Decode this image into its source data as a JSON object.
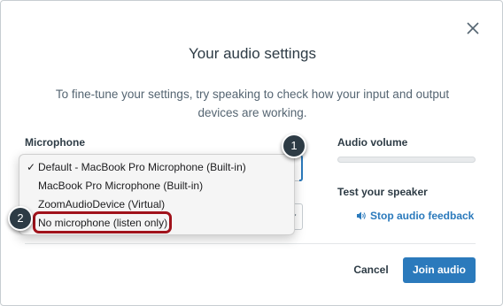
{
  "dialog": {
    "title": "Your audio settings",
    "subtitle": "To fine-tune your settings, try speaking to check how your input and output devices are working."
  },
  "microphone": {
    "label": "Microphone",
    "options": [
      {
        "label": "Default - MacBook Pro Microphone (Built-in)",
        "selected": true
      },
      {
        "label": "MacBook Pro Microphone (Built-in)",
        "selected": false
      },
      {
        "label": "ZoomAudioDevice (Virtual)",
        "selected": false
      },
      {
        "label": "No microphone (listen only)",
        "selected": false
      }
    ],
    "check_glyph": "✓"
  },
  "volume": {
    "label": "Audio volume",
    "level": 0
  },
  "speaker": {
    "label": "Test your speaker",
    "stop_link": "Stop audio feedback"
  },
  "footer": {
    "cancel_label": "Cancel",
    "join_label": "Join audio"
  },
  "callouts": {
    "one": "1",
    "two": "2"
  },
  "colors": {
    "accent": "#2b7abc",
    "highlight": "#a0121b",
    "callout": "#2d3b45"
  },
  "icons": {
    "close": "close-icon",
    "speaker": "speaker-wave-icon",
    "chevron": "chevron-down-icon"
  }
}
